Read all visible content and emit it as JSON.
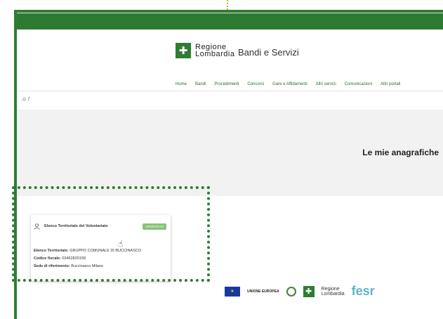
{
  "site": {
    "logo_line1": "Regione",
    "logo_line2": "Lombardia",
    "title": "Bandi e Servizi"
  },
  "nav": [
    "Home",
    "Bandi",
    "Procedimenti",
    "Concorsi",
    "Gare e Affidamenti",
    "Altri servizi",
    "Comunicazioni",
    "Altri portali"
  ],
  "breadcrumb": "⌂ /",
  "hero": {
    "title": "Le mie anagrafiche"
  },
  "card": {
    "title": "Elenco Territoriale del Volontariato",
    "badge": "OPERATIVO",
    "elenco_label": "Elenco Territoriale:",
    "elenco_value": "GRUPPO COMUNALE DI BUCCINASCO",
    "cf_label": "Codice fiscale:",
    "cf_value": "03462820158",
    "sede_label": "Sede di riferimento:",
    "sede_value": "Buccinasco Milano"
  },
  "footer": {
    "eu_text": "UNIONE EUROPEA",
    "rl_line1": "Regione",
    "rl_line2": "Lombardia",
    "fesr": "fesr"
  }
}
